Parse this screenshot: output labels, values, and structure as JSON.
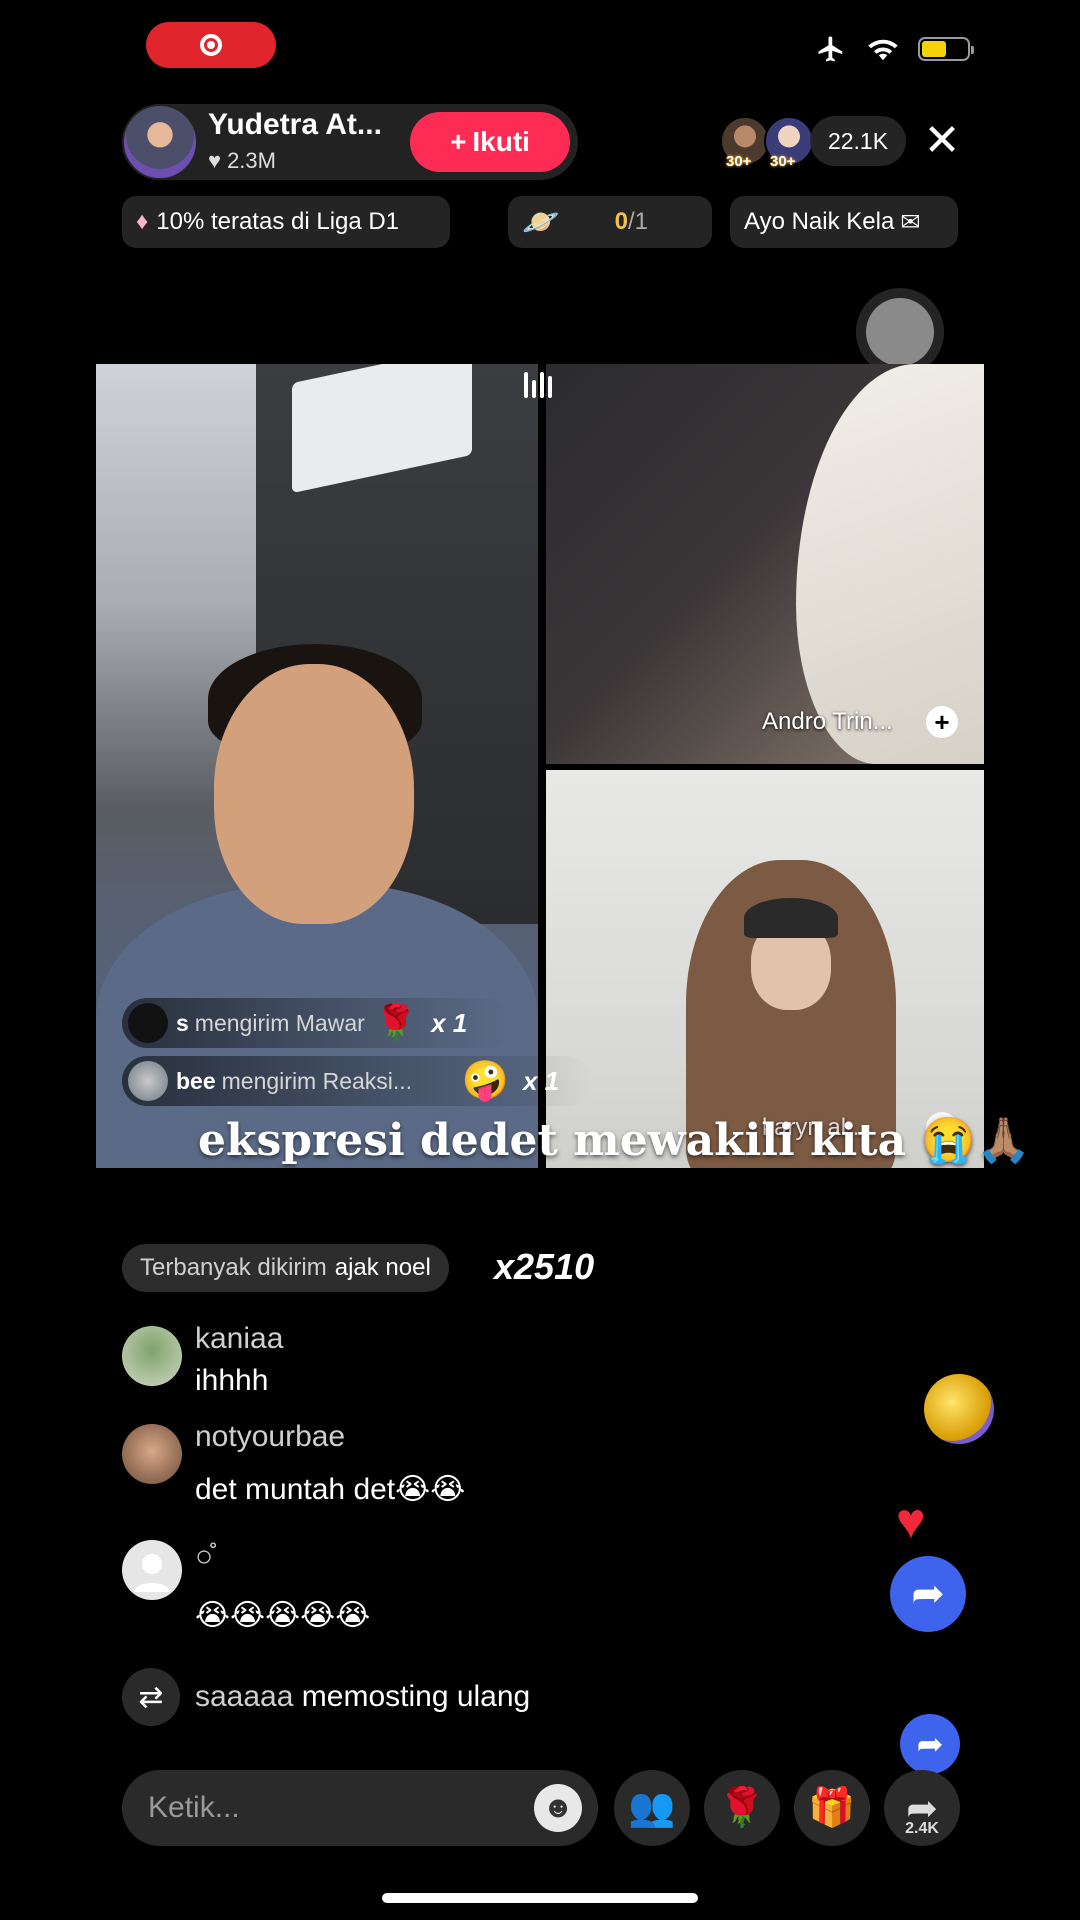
{
  "host": {
    "name": "Yudetra At...",
    "likes": "2.3M",
    "follow_label": "Ikuti"
  },
  "viewers": {
    "badge_1": "30+",
    "badge_2": "30+",
    "count": "22.1K"
  },
  "chips": {
    "rank": "10% teratas di Liga D1",
    "goal_current": "0",
    "goal_total": "/1",
    "promo": "Ayo Naik Kela"
  },
  "guests": {
    "top_right_name": "Andro Trin...",
    "bottom_right_name": "karyn al..."
  },
  "gifts": [
    {
      "user": "s",
      "action": "mengirim Mawar",
      "count": "x 1",
      "icon": "rose-icon"
    },
    {
      "user": "bee",
      "action": "mengirim Reaksi...",
      "count": "x 1",
      "icon": "emoji-reaction-icon"
    }
  ],
  "caption": "ekspresi dedet mewakili kita 😭🙏🏽",
  "top_gifter": {
    "prefix": "Terbanyak dikirim",
    "name": "ajak noel",
    "count": "x2510"
  },
  "comments": [
    {
      "user": "kaniaa",
      "text": "ihhhh"
    },
    {
      "user": "notyourbae",
      "text": "det muntah det😭😭"
    },
    {
      "user": "○̊",
      "text": "😭😭😭😭😭"
    }
  ],
  "repost": {
    "user": "saaaaa",
    "action": "memosting ulang"
  },
  "input": {
    "placeholder": "Ketik..."
  },
  "bottom_bar": {
    "share_count": "2.4K"
  },
  "colors": {
    "accent": "#fe2c55",
    "share_blue": "#3e63ec",
    "record": "#e0252c"
  }
}
